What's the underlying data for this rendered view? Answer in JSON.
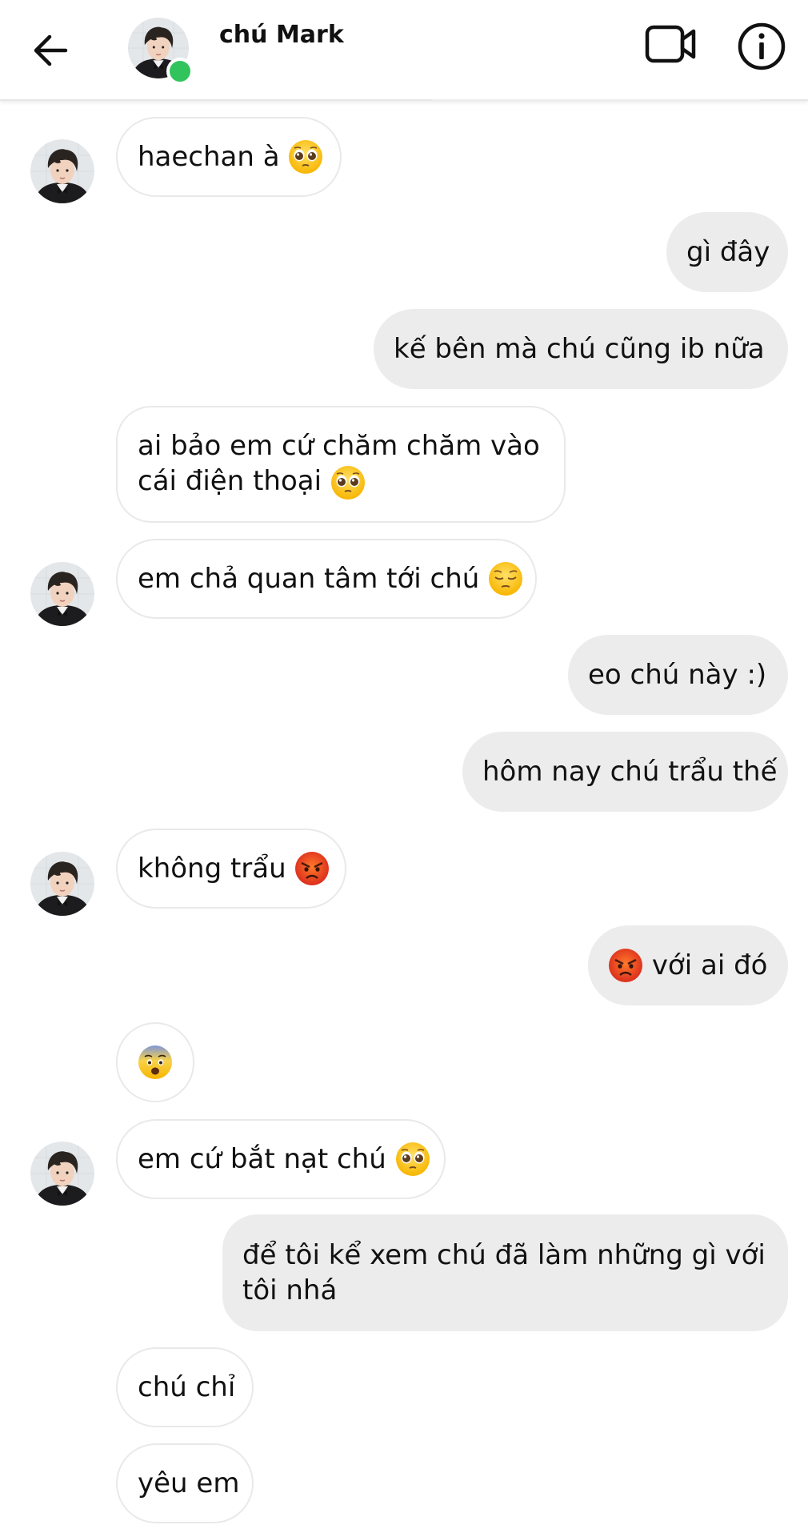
{
  "header": {
    "contact_name": "chú Mark",
    "online": true
  },
  "messages": [
    {
      "id": 1,
      "side": "in",
      "text": "haechan à",
      "emoji": "pleading-face"
    },
    {
      "id": 2,
      "side": "out",
      "text": "gì đây"
    },
    {
      "id": 3,
      "side": "out",
      "text": "kế bên mà chú cũng ib nữa"
    },
    {
      "id": 4,
      "side": "in",
      "lines": [
        "ai bảo em cứ chăm chăm vào",
        "cái điện thoại"
      ],
      "emoji": "pleading-face"
    },
    {
      "id": 5,
      "side": "in",
      "text": "em chả quan tâm tới chú",
      "emoji": "pensive-face"
    },
    {
      "id": 6,
      "side": "out",
      "text": "eo chú này :)"
    },
    {
      "id": 7,
      "side": "out",
      "text": "hôm nay chú trẩu thế"
    },
    {
      "id": 8,
      "side": "in",
      "text": "không trẩu",
      "emoji": "angry-face"
    },
    {
      "id": 9,
      "side": "out",
      "text": "với ai đó",
      "emoji": "angry-face"
    },
    {
      "id": 10,
      "side": "in",
      "text": "",
      "emoji": "fearful-face"
    },
    {
      "id": 11,
      "side": "in",
      "text": "em cứ bắt nạt chú",
      "emoji": "pleading-face"
    },
    {
      "id": 12,
      "side": "out",
      "lines": [
        "để tôi kể xem chú đã làm những gì với",
        "tôi nhá"
      ]
    },
    {
      "id": 13,
      "side": "in",
      "text": "chú chỉ"
    },
    {
      "id": 14,
      "side": "in",
      "text": "yêu em"
    }
  ],
  "colors": {
    "incoming_bg": "#ffffff",
    "outgoing_bg": "#ececec",
    "online": "#31c45c"
  },
  "icons": [
    "back-arrow-icon",
    "video-call-icon",
    "info-icon"
  ]
}
